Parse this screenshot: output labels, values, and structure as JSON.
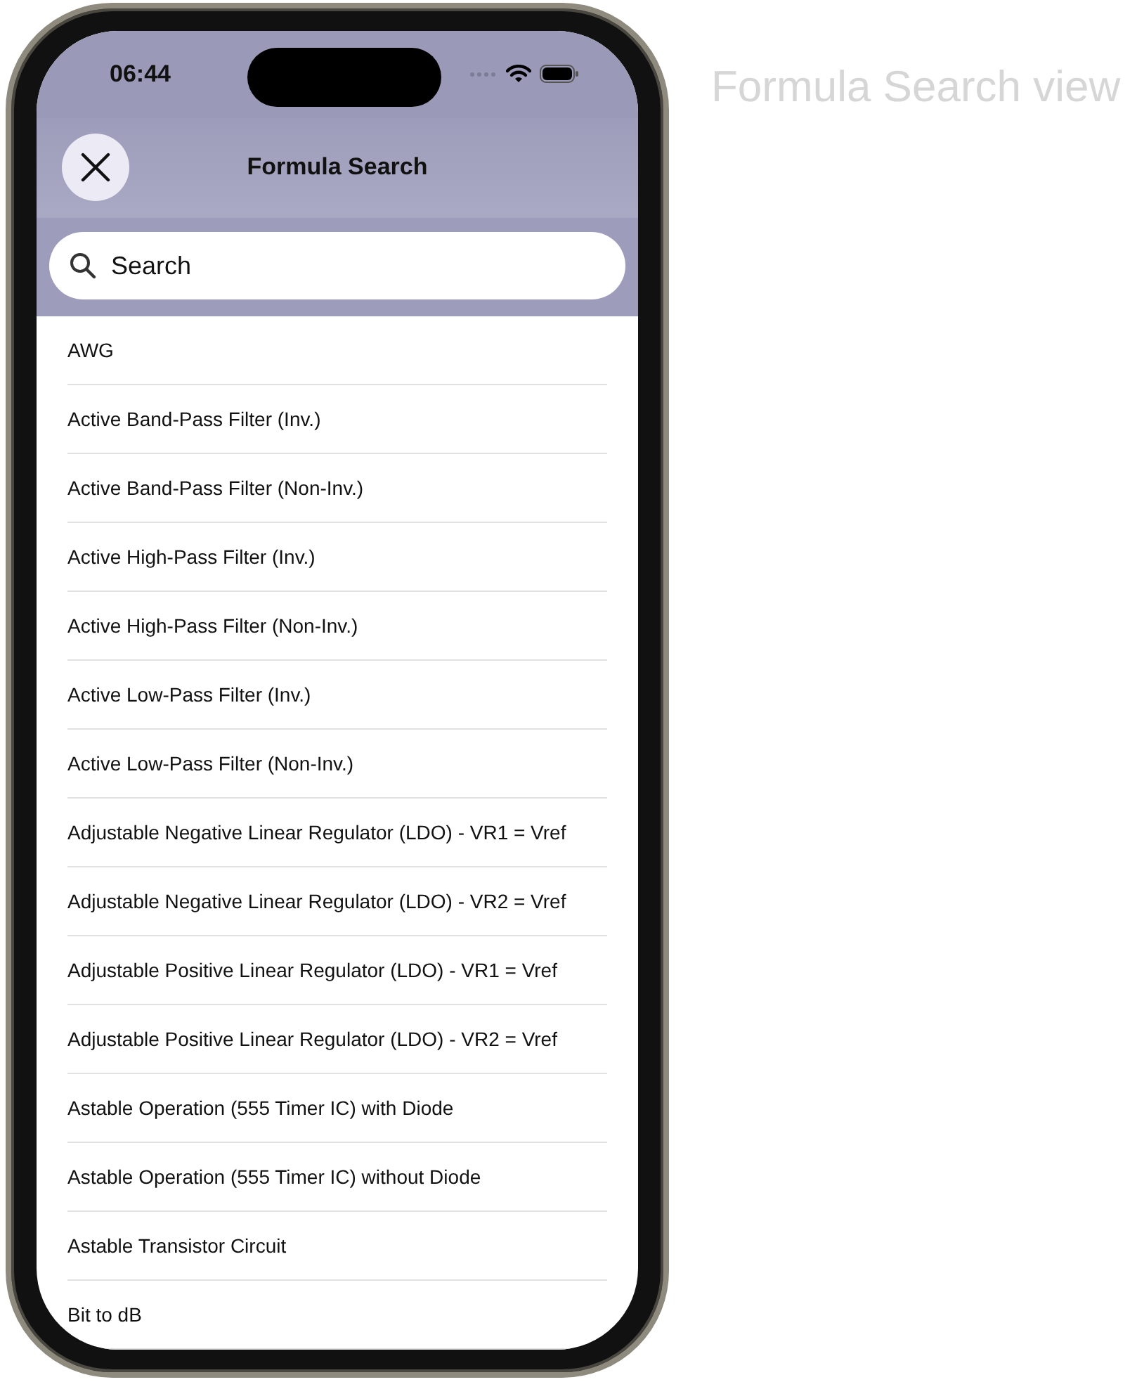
{
  "caption": "Formula Search view",
  "status_bar": {
    "time": "06:44"
  },
  "nav": {
    "title": "Formula Search"
  },
  "search": {
    "placeholder": "Search"
  },
  "formulas": [
    {
      "label": "AWG"
    },
    {
      "label": "Active Band-Pass Filter (Inv.)"
    },
    {
      "label": "Active Band-Pass Filter (Non-Inv.)"
    },
    {
      "label": "Active High-Pass Filter (Inv.)"
    },
    {
      "label": "Active High-Pass Filter (Non-Inv.)"
    },
    {
      "label": "Active Low-Pass Filter (Inv.)"
    },
    {
      "label": "Active Low-Pass Filter (Non-Inv.)"
    },
    {
      "label": "Adjustable Negative Linear Regulator (LDO) - VR1 = Vref"
    },
    {
      "label": "Adjustable Negative Linear Regulator (LDO) - VR2 = Vref"
    },
    {
      "label": "Adjustable Positive Linear Regulator (LDO) - VR1 = Vref"
    },
    {
      "label": "Adjustable Positive Linear Regulator (LDO) - VR2 = Vref"
    },
    {
      "label": "Astable Operation (555 Timer IC) with Diode"
    },
    {
      "label": "Astable Operation (555 Timer IC) without Diode"
    },
    {
      "label": "Astable Transistor Circuit"
    },
    {
      "label": "Bit to dB"
    }
  ]
}
